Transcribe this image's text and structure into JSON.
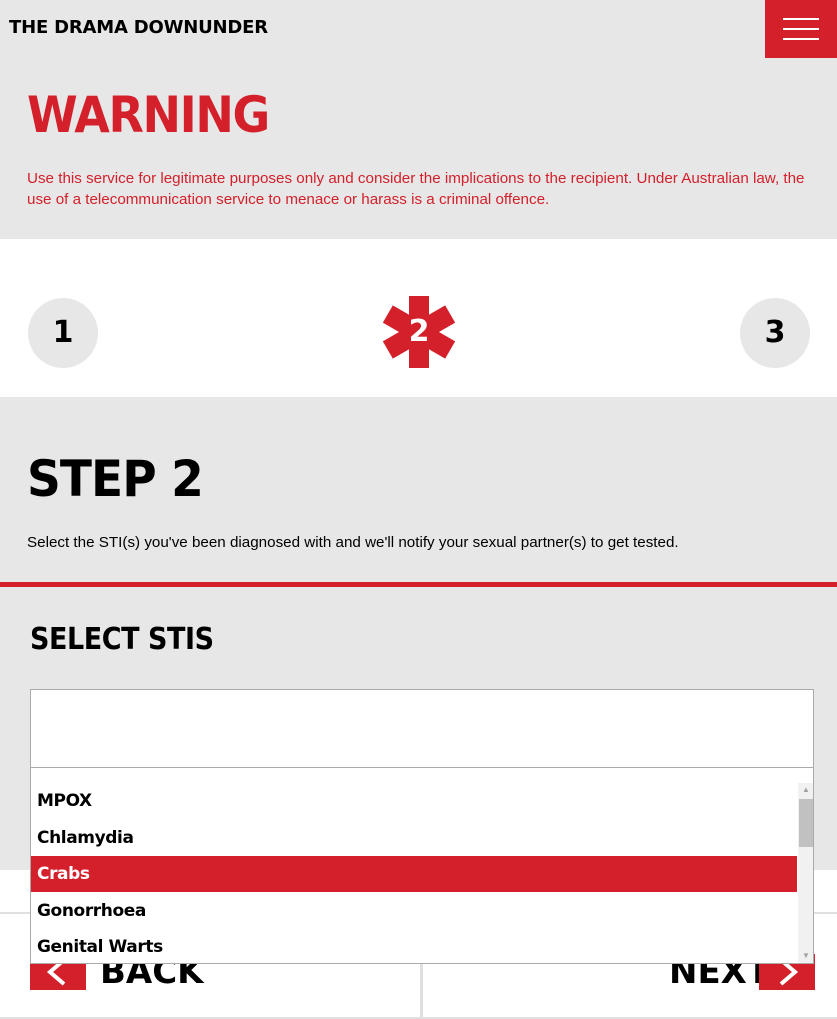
{
  "header": {
    "logo": "THE DRAMA DOWNUNDER",
    "menu_icon": "hamburger-menu-icon"
  },
  "warning": {
    "title": "WARNING",
    "text": "Use this service for legitimate purposes only and consider the implications to the recipient. Under Australian law, the use of a telecommunication service to menace or harass is a criminal offence."
  },
  "steps": {
    "items": [
      "1",
      "2",
      "3"
    ],
    "active": "2",
    "active_icon": "medical-asterisk-icon"
  },
  "step": {
    "title": "STEP 2",
    "description": "Select the STI(s) you've been diagnosed with and we'll notify your sexual partner(s) to get tested."
  },
  "select": {
    "title": "SELECT STIS",
    "search_value": "",
    "options": [
      "MPOX",
      "Chlamydia",
      "Crabs",
      "Gonorrhoea",
      "Genital Warts"
    ],
    "highlighted": "Crabs"
  },
  "nav": {
    "back_label": "BACK",
    "next_label": "NEXT"
  },
  "colors": {
    "accent": "#d4202b",
    "panel": "#e7e7e7"
  }
}
